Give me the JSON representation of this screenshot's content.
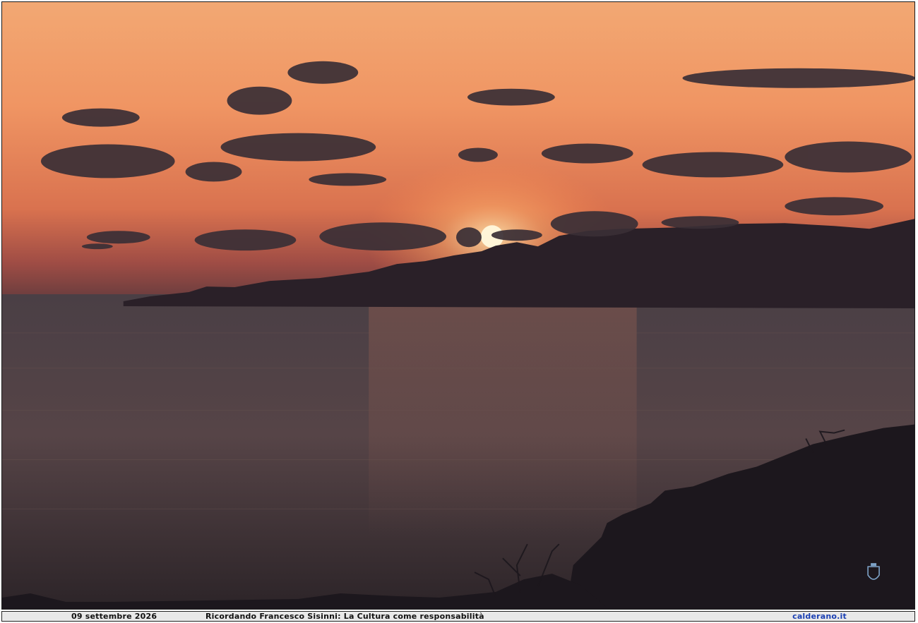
{
  "photo": {
    "subject_icon": "sunset-landscape",
    "colors": {
      "sky_top": "#f2a873",
      "sky_mid": "#ee8858",
      "sky_low": "#b8574c",
      "horizon": "#6b3d3e",
      "sea_top": "#4a4043",
      "sea_bottom": "#2c2428",
      "land": "#1f1a22",
      "sun": "#fff5d8"
    },
    "logo_icon": "crest-icon"
  },
  "footer": {
    "date": "09 settembre 2026",
    "caption": "Ricordando Francesco Sisinni: La Cultura come responsabilità",
    "site": "calderano.it"
  }
}
